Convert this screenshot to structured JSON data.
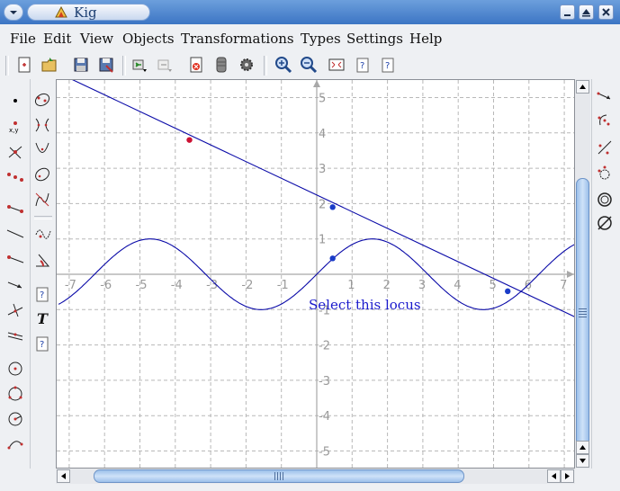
{
  "window": {
    "title": "Kig"
  },
  "menubar": {
    "items": [
      "File",
      "Edit",
      "View",
      "Objects",
      "Transformations",
      "Types",
      "Settings",
      "Help"
    ]
  },
  "toolbar": {
    "icons": [
      "new-document-icon",
      "open-folder-icon",
      "save-icon",
      "save-as-icon",
      "undo-icon",
      "redo-icon",
      "delete-icon",
      "cancel-construction-icon",
      "gear-icon",
      "zoom-in-icon",
      "zoom-out-icon",
      "fit-to-screen-icon",
      "help-icon",
      "info-icon"
    ]
  },
  "left_toolbar": {
    "icons": [
      "point-icon",
      "coordinate-point-icon",
      "intersection-point-icon",
      "midpoint-icon",
      "segment-icon",
      "line-icon",
      "ray-icon",
      "vector-icon",
      "perpendicular-icon",
      "parallel-icon",
      "circle-center-point-icon",
      "circle-three-points-icon",
      "circle-center-radius-icon",
      "arc-icon"
    ]
  },
  "second_toolbar": {
    "icons": [
      "conic-five-points-icon",
      "hyperbola-icon",
      "parabola-icon",
      "ellipse-icon",
      "cubic-icon",
      "locus-icon",
      "angle-icon",
      "script-icon",
      "text-label-icon",
      "python-script-icon"
    ]
  },
  "right_toolbar": {
    "icons": [
      "translate-icon",
      "rotate-icon",
      "reflect-line-icon",
      "scale-icon",
      "circle-inversion-icon",
      "harmonic-homology-icon"
    ]
  },
  "canvas": {
    "hover_label": "Select this locus",
    "label_color": "#1a1acc",
    "curve_color": "#0a0aa8",
    "grid_color": "#b8b8b8",
    "axis_color": "#a8a8a8",
    "point_red": "#cc1133",
    "point_blue": "#1a3cc8"
  },
  "chart_data": {
    "type": "line",
    "xlim": [
      -7,
      7
    ],
    "ylim": [
      -5,
      5
    ],
    "x_ticks": [
      "-7",
      "-6",
      "-5",
      "-4",
      "-3",
      "-2",
      "-1",
      "1",
      "2",
      "3",
      "4",
      "5",
      "6",
      "7"
    ],
    "y_ticks": [
      "5",
      "4",
      "3",
      "2",
      "1",
      "-1",
      "-2",
      "-3",
      "-4",
      "-5"
    ],
    "grid": true,
    "series": [
      {
        "kind": "line",
        "x": [
          -7.0,
          7.5
        ],
        "y": [
          5.55,
          -1.3
        ]
      },
      {
        "kind": "locus",
        "function": "sin",
        "x_range": [
          -7.3,
          7.3
        ]
      }
    ],
    "points": [
      {
        "x": -3.6,
        "y": 3.8,
        "color": "red"
      },
      {
        "x": 0.45,
        "y": 1.9,
        "color": "blue"
      },
      {
        "x": 0.45,
        "y": 0.45,
        "color": "blue"
      },
      {
        "x": 5.4,
        "y": -0.48,
        "color": "blue"
      }
    ]
  }
}
